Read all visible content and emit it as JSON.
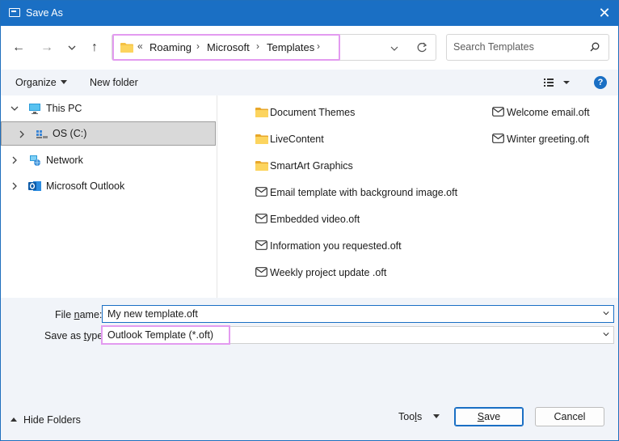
{
  "window": {
    "title": "Save As",
    "close_glyph": "✕"
  },
  "nav": {
    "back_glyph": "←",
    "forward_glyph": "→",
    "recent_glyph": "⌄",
    "up_glyph": "↑",
    "address": {
      "overflow": "«",
      "crumbs": [
        "Roaming",
        "Microsoft",
        "Templates"
      ],
      "separator": "›",
      "dropdown_glyph": "⌄",
      "refresh_glyph": "↻"
    },
    "search_placeholder": "Search Templates"
  },
  "toolbar": {
    "organize": "Organize",
    "new_folder": "New folder",
    "help": "?"
  },
  "tree": [
    {
      "label": "This PC",
      "expanded": true,
      "icon": "monitor-icon"
    },
    {
      "label": "OS (C:)",
      "expanded": false,
      "icon": "drive-icon",
      "selected": true
    },
    {
      "label": "Network",
      "expanded": false,
      "icon": "network-icon"
    },
    {
      "label": "Microsoft Outlook",
      "expanded": false,
      "icon": "outlook-icon"
    }
  ],
  "files": [
    {
      "name": "Document Themes",
      "type": "folder"
    },
    {
      "name": "LiveContent",
      "type": "folder"
    },
    {
      "name": "SmartArt Graphics",
      "type": "folder"
    },
    {
      "name": "Email template with background image.oft",
      "type": "mail"
    },
    {
      "name": "Embedded video.oft",
      "type": "mail"
    },
    {
      "name": "Information you requested.oft",
      "type": "mail"
    },
    {
      "name": "Weekly project update .oft",
      "type": "mail"
    },
    {
      "name": "Welcome email.oft",
      "type": "mail"
    },
    {
      "name": "Winter greeting.oft",
      "type": "mail"
    }
  ],
  "form": {
    "file_name_label_pre": "File ",
    "file_name_label_key": "n",
    "file_name_label_post": "ame:",
    "file_name_value": "My new template.oft",
    "save_type_label_pre": "Save as ",
    "save_type_label_key": "t",
    "save_type_label_post": "ype:",
    "save_type_value": "Outlook Template (*.oft)"
  },
  "footer": {
    "hide_folders": "Hide Folders",
    "tools_pre": "Too",
    "tools_key": "l",
    "tools_post": "s",
    "save_key": "S",
    "save_post": "ave",
    "cancel": "Cancel"
  },
  "colors": {
    "accent": "#1a6fc4",
    "highlight": "#e39bf0",
    "folder": "#f4c143"
  }
}
